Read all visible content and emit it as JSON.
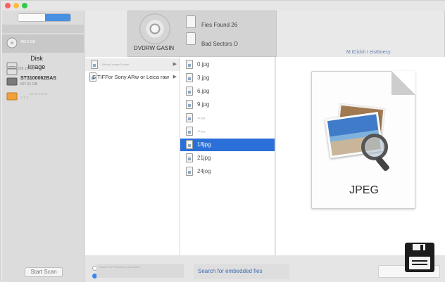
{
  "sidebar": {
    "drives": [
      {
        "name": "",
        "sub": "465.9 GB"
      },
      {
        "name": "Disk image",
        "sub": ""
      },
      {
        "name": "",
        "sub": "228.12 GB"
      },
      {
        "name": "ST3100062BAS",
        "sub": "697.91 GB"
      },
      {
        "name": "",
        "sub": "",
        "sub2": "Fat 16 / Fat 32"
      },
      {
        "name": "",
        "sub": "7 7 7"
      }
    ],
    "start_scan_label": "Start Scan"
  },
  "top_panel": {
    "volume_label": "DVDRW GASIN",
    "files_found": "Fies Found 26",
    "bad_sectors": "Bad Sectors O"
  },
  "columns": {
    "col1": [
      {
        "label": "Bitmap Image Format",
        "chevron": "▶"
      },
      {
        "label": "S TIFFor Sony ARw or Leica raw",
        "chevron": "▶"
      }
    ],
    "col2": [
      "0.jpg",
      "3.jpg",
      "6.jpg",
      "9.jpg",
      "12.jpg",
      "15.jpg",
      "18jpg",
      "21jpg",
      "24jog"
    ],
    "selected_index": 6
  },
  "preview": {
    "hint": "M tCickh t eistttoecy",
    "type_label": "JPEG"
  },
  "bottom": {
    "option_text": "Search for Photoshop document",
    "embedded_label": "Search for embedded fies"
  },
  "icons": {
    "drive": "hard-drive-icon",
    "file": "file-icon",
    "save": "floppy-disk-icon"
  }
}
